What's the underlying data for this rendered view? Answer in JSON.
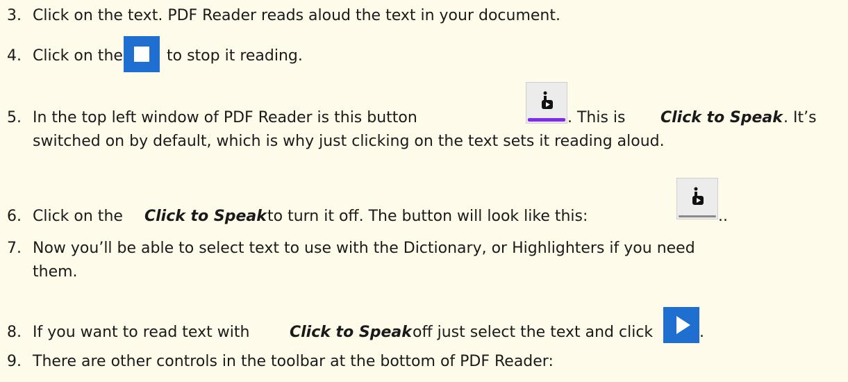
{
  "steps": [
    {
      "num": "3.",
      "text": "Click on the text. PDF Reader reads aloud the text in your document."
    },
    {
      "num": "4.",
      "before": "Click on the",
      "after": "to stop it reading."
    },
    {
      "num": "5.",
      "before": "In the top left window of PDF Reader is this button",
      "mid": ".  This is ",
      "bold": "Click to Speak",
      "after": ".  It’s",
      "line2": "switched on by default, which is why just clicking on the text sets it reading aloud."
    },
    {
      "num": "6.",
      "before": "Click on the ",
      "bold": "Click to Speak",
      "after": " to turn it off.  The button will look like this:",
      "end": ".."
    },
    {
      "num": "7.",
      "text": "Now you’ll be able to select text to use with the Dictionary, or Highlighters if you need",
      "line2": "them."
    },
    {
      "num": "8.",
      "before": "If you want to read text with ",
      "bold": "Click to Speak",
      "after": " off just select the text and click",
      "end": "."
    },
    {
      "num": "9.",
      "text": "There are other controls in the toolbar at the bottom of PDF Reader:"
    }
  ],
  "icons": {
    "stop": "stop-square-icon",
    "click_to_speak_on": "click-to-speak-on-icon",
    "click_to_speak_off": "click-to-speak-off-icon",
    "play": "play-icon"
  },
  "colors": {
    "background": "#fffbea",
    "icon_blue": "#1f6fd0",
    "active_bar": "#7d2bf0"
  }
}
